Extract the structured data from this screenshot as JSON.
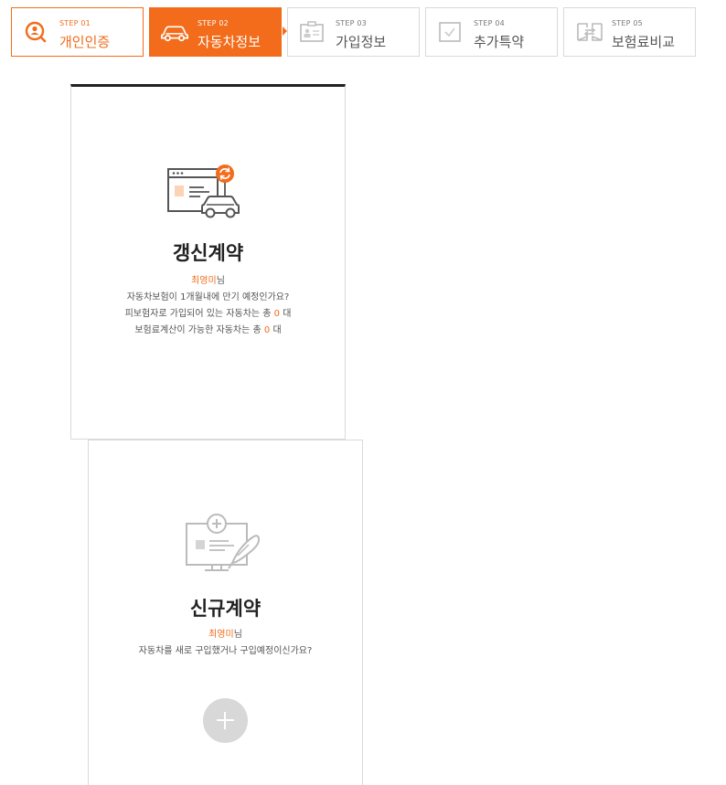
{
  "steps": [
    {
      "num": "STEP 01",
      "name": "개인인증",
      "state": "done",
      "icon": "search-person-icon"
    },
    {
      "num": "STEP 02",
      "name": "자동차정보",
      "state": "active",
      "icon": "car-icon"
    },
    {
      "num": "STEP 03",
      "name": "가입정보",
      "state": "pending",
      "icon": "id-card-icon"
    },
    {
      "num": "STEP 04",
      "name": "추가특약",
      "state": "pending",
      "icon": "checkbox-icon"
    },
    {
      "num": "STEP 05",
      "name": "보험료비교",
      "state": "pending",
      "icon": "compare-icon"
    }
  ],
  "colors": {
    "accent": "#f26c1b",
    "border": "#d9d9d9",
    "title": "#222222",
    "muted": "#555555"
  },
  "renewal": {
    "title": "갱신계약",
    "user_name": "최영미",
    "user_suffix": "님",
    "line1": "자동차보험이 1개월내에 만기 예정인가요?",
    "line2_prefix": "피보험자로 가입되어 있는 자동차는 총",
    "line2_count": "0",
    "line2_suffix": "대",
    "line3_prefix": "보험료계산이 가능한 자동차는 총",
    "line3_count": "0",
    "line3_suffix": "대"
  },
  "new_contract": {
    "title": "신규계약",
    "user_name": "최영미",
    "user_suffix": "님",
    "line1": "자동차를 새로 구입했거나 구입예정이신가요?"
  }
}
